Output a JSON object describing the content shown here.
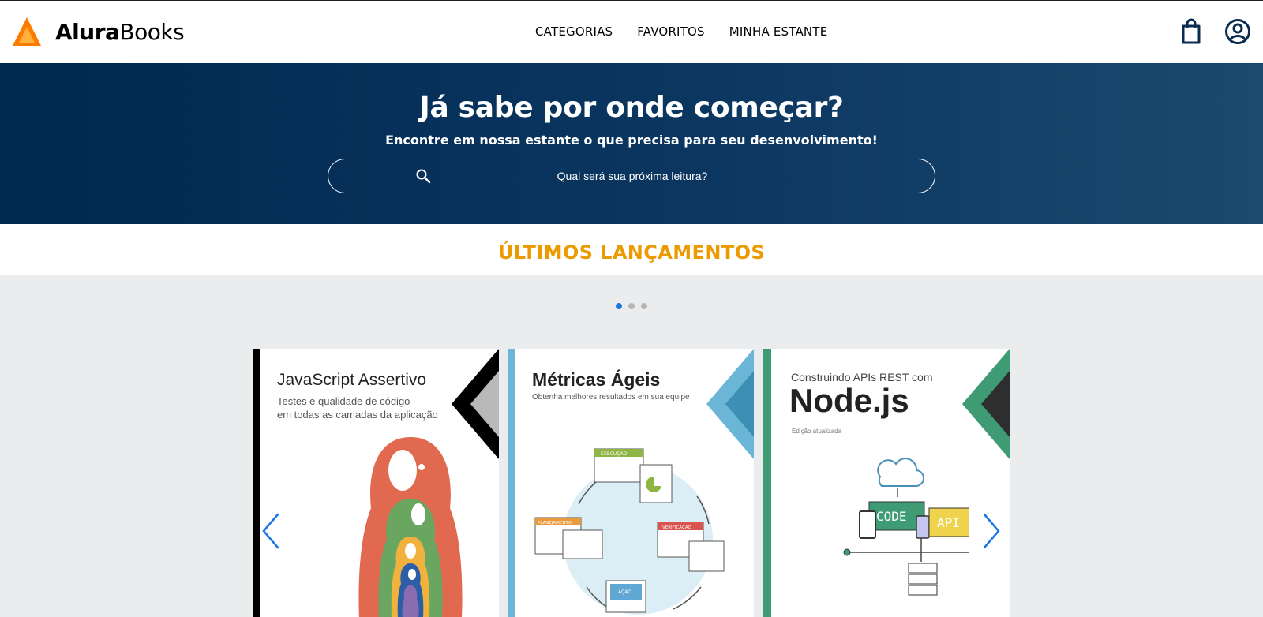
{
  "brand": {
    "name_bold": "Alura",
    "name_light": "Books",
    "accent": "#ff7b00"
  },
  "nav": {
    "items": [
      "CATEGORIAS",
      "FAVORITOS",
      "MINHA ESTANTE"
    ]
  },
  "hero": {
    "title": "Já sabe por onde começar?",
    "subtitle": "Encontre em nossa estante o que precisa para seu desenvolvimento!",
    "search_placeholder": "Qual será sua próxima leitura?"
  },
  "section": {
    "title": "ÚLTIMOS LANÇAMENTOS",
    "color": "#eb9b00"
  },
  "carousel": {
    "page_count": 3,
    "active_page": 0,
    "books": [
      {
        "title": "JavaScript Assertivo",
        "subtitle_line1": "Testes e qualidade de código",
        "subtitle_line2": "em todas as camadas da aplicação",
        "spine_color": "#000000"
      },
      {
        "title": "Métricas Ágeis",
        "subtitle_line1": "Obtenha melhores resultados em sua equipe",
        "spine_color": "#6bb6d6",
        "labels": {
          "execucao": "EXECUÇÃO",
          "planejamento": "PLANEJAMENTO",
          "verificacao": "VERIFICAÇÃO",
          "acao": "AÇÃO"
        }
      },
      {
        "overline": "Construindo APIs REST com",
        "title": "Node.js",
        "edition": "Edição atualizada",
        "spine_color": "#3f9b74",
        "labels": {
          "code": "CODE",
          "api": "API"
        }
      }
    ]
  },
  "icons": {
    "logo": "triangle-logo-icon",
    "cart": "shopping-bag-icon",
    "account": "user-circle-icon",
    "search": "search-icon",
    "prev": "chevron-left-icon",
    "next": "chevron-right-icon"
  }
}
